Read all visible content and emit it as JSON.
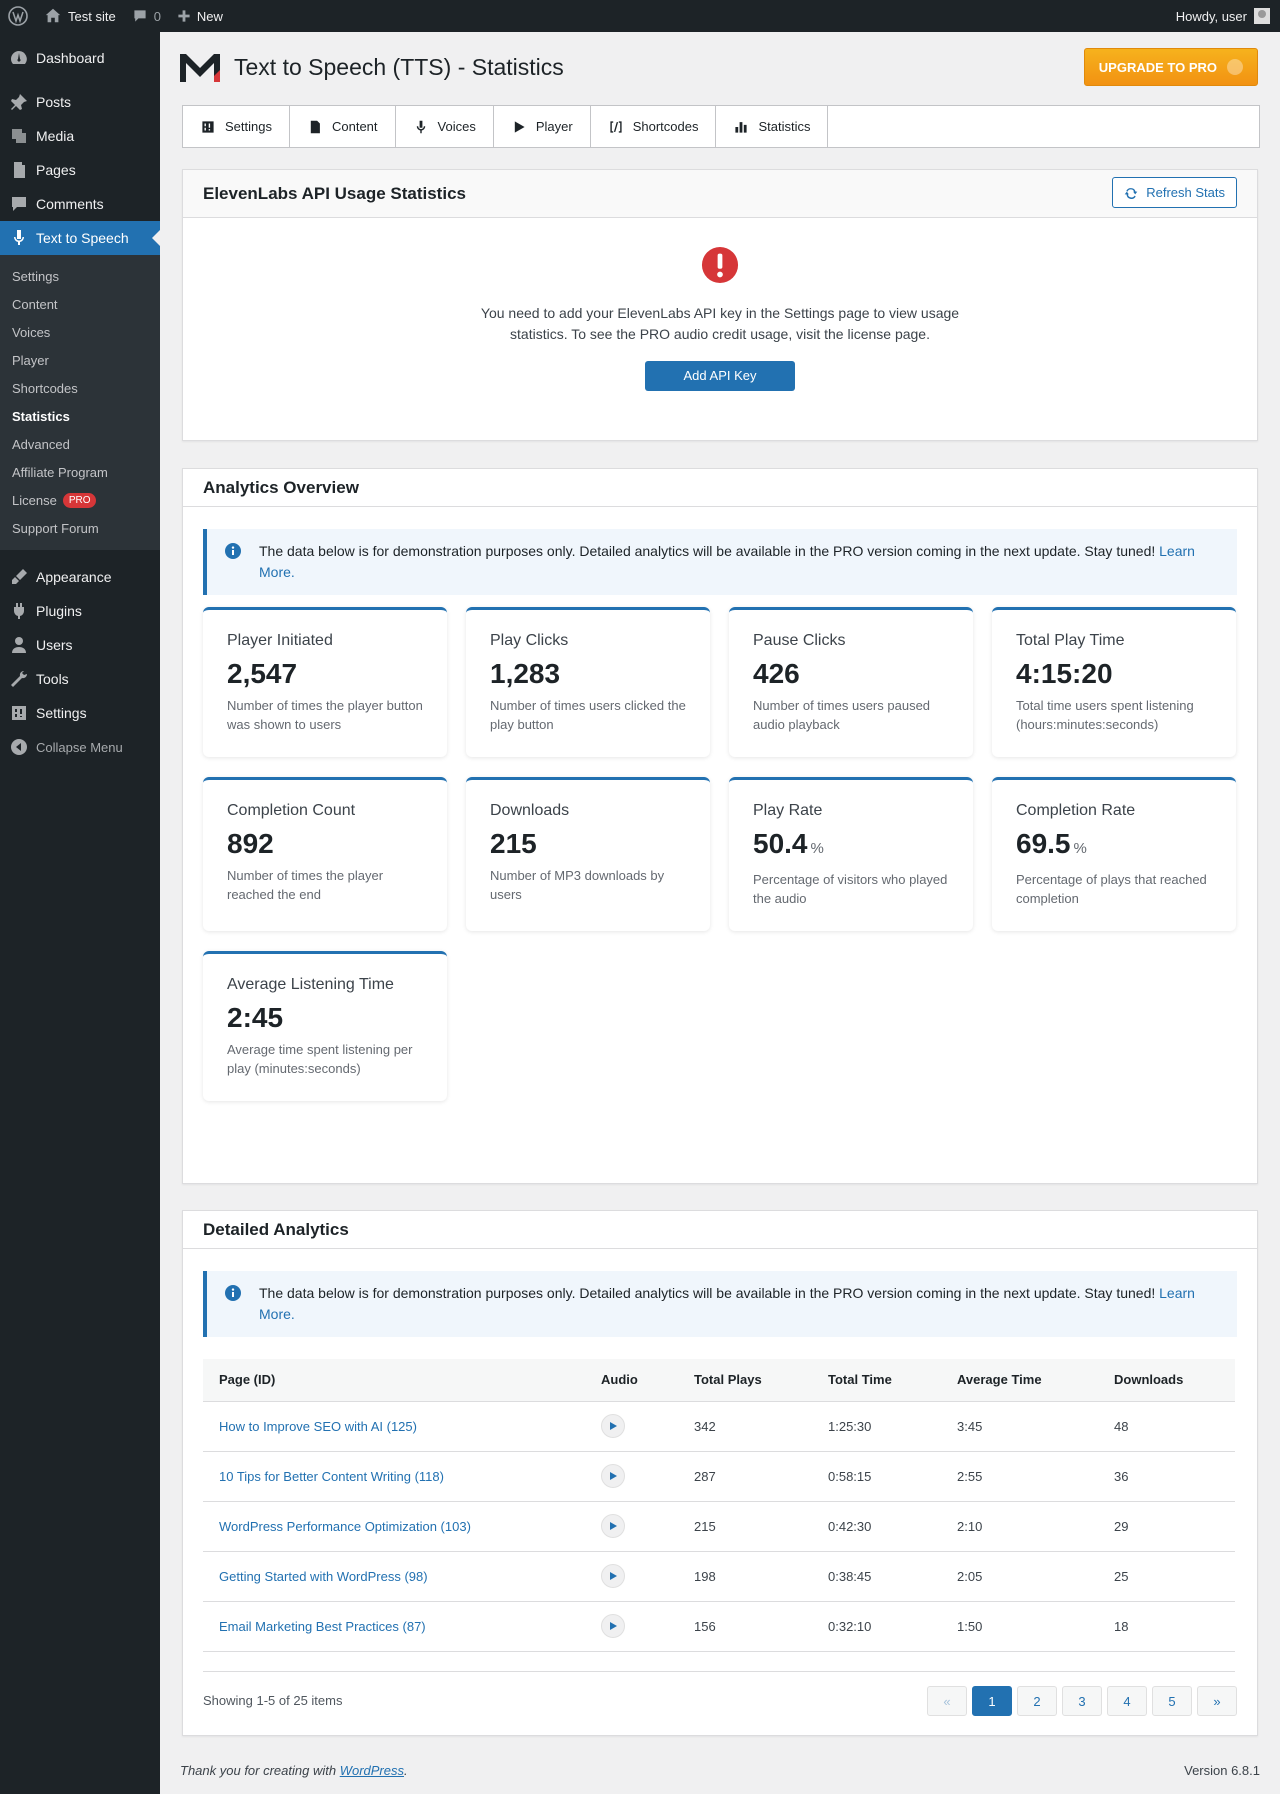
{
  "adminbar": {
    "site_name": "Test site",
    "comments_count": "0",
    "new_label": "New",
    "howdy": "Howdy, user"
  },
  "sidebar": {
    "dashboard": "Dashboard",
    "posts": "Posts",
    "media": "Media",
    "pages": "Pages",
    "comments": "Comments",
    "tts": "Text to Speech",
    "sub": [
      "Settings",
      "Content",
      "Voices",
      "Player",
      "Shortcodes",
      "Statistics",
      "Advanced",
      "Affiliate Program",
      "License",
      "Support Forum"
    ],
    "license_badge": "PRO",
    "appearance": "Appearance",
    "plugins": "Plugins",
    "users": "Users",
    "tools": "Tools",
    "settings": "Settings",
    "collapse": "Collapse Menu"
  },
  "header": {
    "title": "Text to Speech (TTS) - Statistics",
    "upgrade": "UPGRADE TO PRO"
  },
  "tabs": [
    "Settings",
    "Content",
    "Voices",
    "Player",
    "Shortcodes",
    "Statistics"
  ],
  "api_card": {
    "title": "ElevenLabs API Usage Statistics",
    "refresh": "Refresh Stats",
    "message": "You need to add your ElevenLabs API key in the Settings page to view usage statistics. To see the PRO audio credit usage, visit the license page.",
    "button": "Add API Key"
  },
  "analytics": {
    "title": "Analytics Overview",
    "notice": "The data below is for demonstration purposes only. Detailed analytics will be available in the PRO version coming in the next update. Stay tuned!",
    "notice_link": "Learn More.",
    "stats": [
      {
        "label": "Player Initiated",
        "value": "2,547",
        "unit": "",
        "desc": "Number of times the player button was shown to users"
      },
      {
        "label": "Play Clicks",
        "value": "1,283",
        "unit": "",
        "desc": "Number of times users clicked the play button"
      },
      {
        "label": "Pause Clicks",
        "value": "426",
        "unit": "",
        "desc": "Number of times users paused audio playback"
      },
      {
        "label": "Total Play Time",
        "value": "4:15:20",
        "unit": "",
        "desc": "Total time users spent listening (hours:minutes:seconds)"
      },
      {
        "label": "Completion Count",
        "value": "892",
        "unit": "",
        "desc": "Number of times the player reached the end"
      },
      {
        "label": "Downloads",
        "value": "215",
        "unit": "",
        "desc": "Number of MP3 downloads by users"
      },
      {
        "label": "Play Rate",
        "value": "50.4",
        "unit": "%",
        "desc": "Percentage of visitors who played the audio"
      },
      {
        "label": "Completion Rate",
        "value": "69.5",
        "unit": "%",
        "desc": "Percentage of plays that reached completion"
      },
      {
        "label": "Average Listening Time",
        "value": "2:45",
        "unit": "",
        "desc": "Average time spent listening per play (minutes:seconds)"
      }
    ]
  },
  "detailed": {
    "title": "Detailed Analytics",
    "notice": "The data below is for demonstration purposes only. Detailed analytics will be available in the PRO version coming in the next update. Stay tuned!",
    "notice_link": "Learn More.",
    "columns": [
      "Page (ID)",
      "Audio",
      "Total Plays",
      "Total Time",
      "Average Time",
      "Downloads"
    ],
    "rows": [
      {
        "page": "How to Improve SEO with AI (125)",
        "plays": "342",
        "total": "1:25:30",
        "avg": "3:45",
        "downloads": "48"
      },
      {
        "page": "10 Tips for Better Content Writing (118)",
        "plays": "287",
        "total": "0:58:15",
        "avg": "2:55",
        "downloads": "36"
      },
      {
        "page": "WordPress Performance Optimization (103)",
        "plays": "215",
        "total": "0:42:30",
        "avg": "2:10",
        "downloads": "29"
      },
      {
        "page": "Getting Started with WordPress (98)",
        "plays": "198",
        "total": "0:38:45",
        "avg": "2:05",
        "downloads": "25"
      },
      {
        "page": "Email Marketing Best Practices (87)",
        "plays": "156",
        "total": "0:32:10",
        "avg": "1:50",
        "downloads": "18"
      }
    ],
    "showing": "Showing 1-5 of 25 items",
    "pager": [
      "«",
      "1",
      "2",
      "3",
      "4",
      "5",
      "»"
    ]
  },
  "footer": {
    "thanks": "Thank you for creating with",
    "link": "WordPress",
    "period": ".",
    "version": "Version 6.8.1"
  },
  "colors": {
    "accent": "#2271b1",
    "upgrade": "#f29212",
    "error": "#d63638"
  }
}
